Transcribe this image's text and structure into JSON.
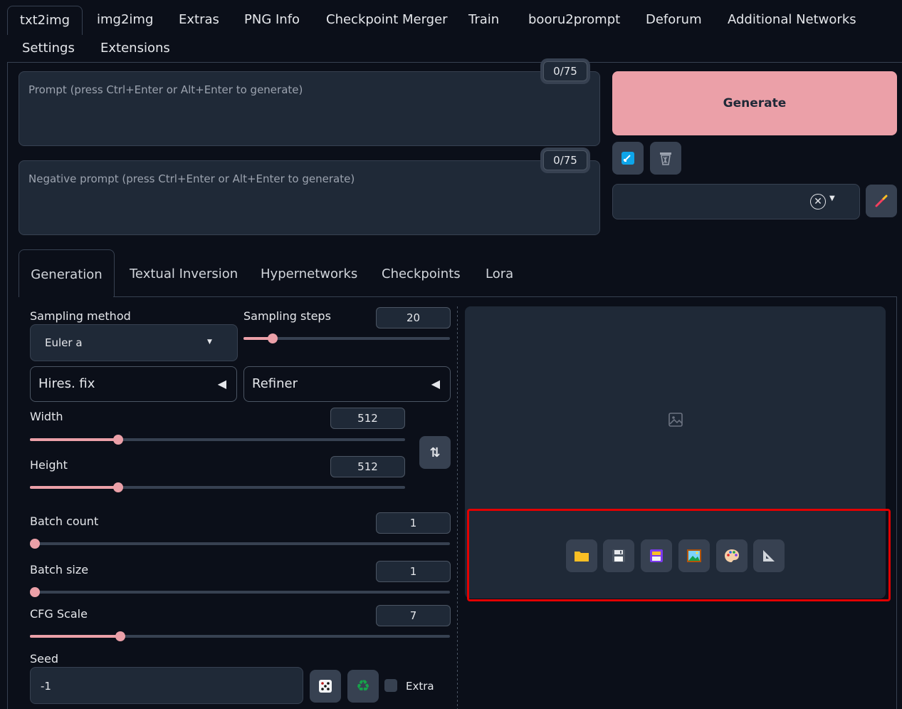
{
  "top_tabs": [
    {
      "label": "txt2img"
    },
    {
      "label": "img2img"
    },
    {
      "label": "Extras"
    },
    {
      "label": "PNG Info"
    },
    {
      "label": "Checkpoint Merger"
    },
    {
      "label": "Train"
    },
    {
      "label": "booru2prompt"
    },
    {
      "label": "Deforum"
    },
    {
      "label": "Additional Networks"
    },
    {
      "label": "Settings"
    },
    {
      "label": "Extensions"
    }
  ],
  "prompt": {
    "placeholder": "Prompt (press Ctrl+Enter or Alt+Enter to generate)",
    "token_count": "0/75"
  },
  "negative_prompt": {
    "placeholder": "Negative prompt (press Ctrl+Enter or Alt+Enter to generate)",
    "token_count": "0/75"
  },
  "generate_label": "Generate",
  "sub_tabs": [
    {
      "label": "Generation"
    },
    {
      "label": "Textual Inversion"
    },
    {
      "label": "Hypernetworks"
    },
    {
      "label": "Checkpoints"
    },
    {
      "label": "Lora"
    }
  ],
  "sampling_method": {
    "label": "Sampling method",
    "value": "Euler a"
  },
  "sampling_steps": {
    "label": "Sampling steps",
    "value": "20",
    "fraction": 0.14
  },
  "hires_fix": {
    "label": "Hires. fix"
  },
  "refiner": {
    "label": "Refiner"
  },
  "width": {
    "label": "Width",
    "value": "512",
    "fraction": 0.235
  },
  "height": {
    "label": "Height",
    "value": "512",
    "fraction": 0.235
  },
  "batch_count": {
    "label": "Batch count",
    "value": "1",
    "fraction": 0
  },
  "batch_size": {
    "label": "Batch size",
    "value": "1",
    "fraction": 0
  },
  "cfg_scale": {
    "label": "CFG Scale",
    "value": "7",
    "fraction": 0.215
  },
  "seed": {
    "label": "Seed",
    "value": "-1",
    "extra_label": "Extra"
  },
  "colors": {
    "accent": "#eba0a8",
    "highlight": "#e30000",
    "background": "#0b0f19"
  }
}
